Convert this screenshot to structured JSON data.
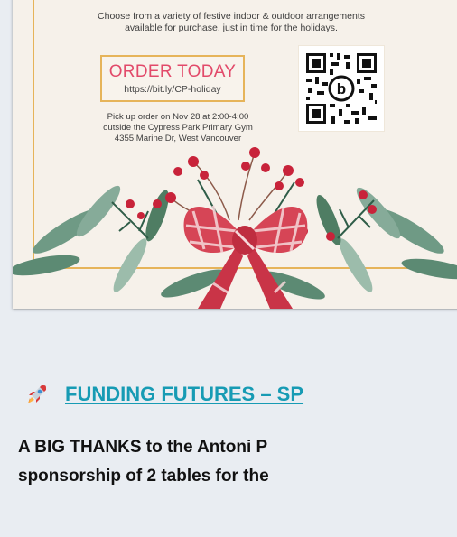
{
  "flyer": {
    "intro_line1": "Choose from a variety of festive indoor & outdoor arrangements",
    "intro_line2": "available for purchase, just in time for the holidays.",
    "order_title": "ORDER TODAY",
    "order_url": "https://bit.ly/CP-holiday",
    "pickup_line1": "Pick up order on Nov 28 at 2:00-4:00",
    "pickup_line2": "outside the Cypress Park Primary Gym",
    "pickup_line3": "4355 Marine Dr, West Vancouver",
    "qr_icon": "qr-code-icon",
    "accent_gold": "#e6b45a",
    "accent_pink": "#e24a6a"
  },
  "article": {
    "heading_icon": "rocket-icon",
    "heading": "FUNDING FUTURES – SP",
    "body_line1": "A BIG THANKS to the Antoni P",
    "body_line2": "sponsorship of 2 tables for the",
    "link_color": "#179bb4"
  }
}
